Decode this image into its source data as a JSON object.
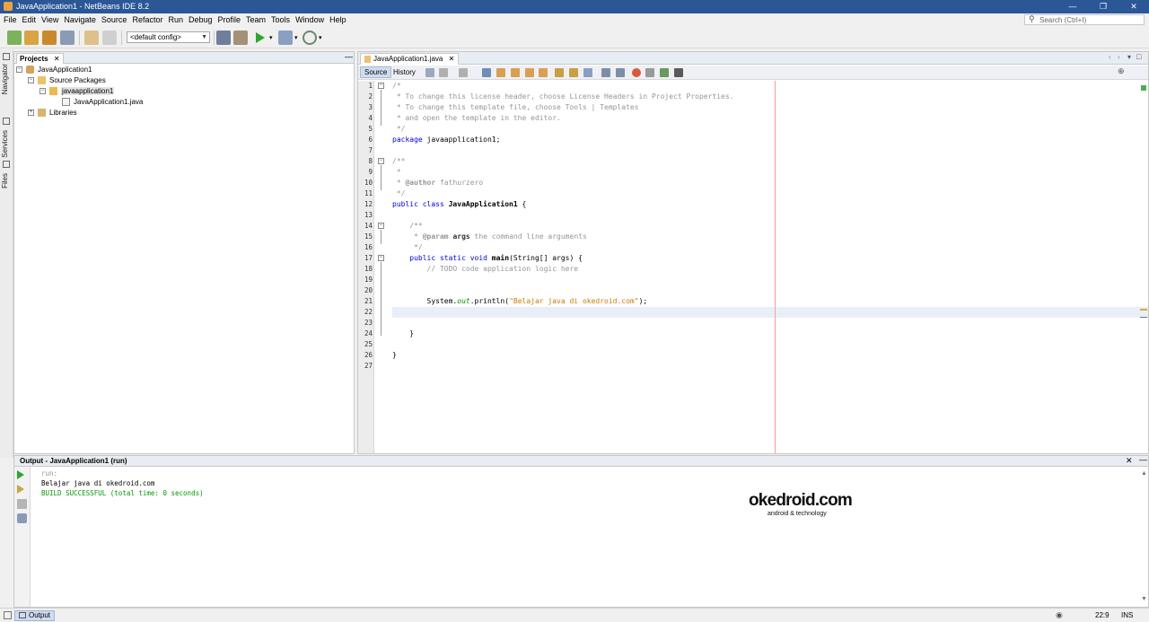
{
  "window": {
    "title": "JavaApplication1 - NetBeans IDE 8.2"
  },
  "menu": [
    "File",
    "Edit",
    "View",
    "Navigate",
    "Source",
    "Refactor",
    "Run",
    "Debug",
    "Profile",
    "Team",
    "Tools",
    "Window",
    "Help"
  ],
  "search": {
    "placeholder": "Search (Ctrl+I)"
  },
  "toolbar": {
    "config": "<default config>"
  },
  "side_tabs": {
    "navigator": "Navigator",
    "services": "Services",
    "files": "Files"
  },
  "projects": {
    "tab": "Projects",
    "tree": {
      "project": "JavaApplication1",
      "source_packages": "Source Packages",
      "package": "javaapplication1",
      "file": "JavaApplication1.java",
      "libraries": "Libraries"
    }
  },
  "editor": {
    "tab": "JavaApplication1.java",
    "source_btn": "Source",
    "history_btn": "History",
    "line_numbers": [
      "1",
      "2",
      "3",
      "4",
      "5",
      "6",
      "7",
      "8",
      "9",
      "10",
      "11",
      "12",
      "13",
      "14",
      "15",
      "16",
      "17",
      "18",
      "19",
      "20",
      "21",
      "22",
      "23",
      "24",
      "25",
      "26",
      "27"
    ],
    "code": {
      "l1": "/*",
      "l2": " * To change this license header, choose License Headers in Project Properties.",
      "l3": " * To change this template file, choose Tools | Templates",
      "l4": " * and open the template in the editor.",
      "l5": " */",
      "l6_kw": "package",
      "l6_rest": " javaapplication1;",
      "l8": "/**",
      "l9": " *",
      "l10_pre": " * ",
      "l10_tag": "@author",
      "l10_rest": " fathurzero",
      "l11": " */",
      "l12_kw": "public class",
      "l12_name": " JavaApplication1",
      "l12_rest": " {",
      "l14": "    /**",
      "l15_pre": "     * ",
      "l15_tag": "@param",
      "l15_arg": " args",
      "l15_rest": " the command line arguments",
      "l16": "     */",
      "l17_kw": "    public static void",
      "l17_name": " main",
      "l17_rest": "(String[] args) {",
      "l18": "        // TODO code application logic here",
      "l21_a": "        System.",
      "l21_field": "out",
      "l21_b": ".println(",
      "l21_str": "\"Belajar java di okedroid.com\"",
      "l21_c": ");",
      "l24": "    }",
      "l26": "}"
    }
  },
  "output": {
    "title": "Output - JavaApplication1 (run)",
    "lines": {
      "run": "run:",
      "out": "Belajar java di okedroid.com",
      "build": "BUILD SUCCESSFUL (total time: 0 seconds)"
    }
  },
  "watermark": {
    "brand": "okedroid.com",
    "tagline": "android & technology"
  },
  "statusbar": {
    "output_tab": "Output",
    "position": "22:9",
    "mode": "INS"
  },
  "colors": {
    "title_bar": "#2b5797",
    "keyword": "#0000e6",
    "comment": "#969696",
    "string": "#ce7b00",
    "success": "#009900"
  }
}
